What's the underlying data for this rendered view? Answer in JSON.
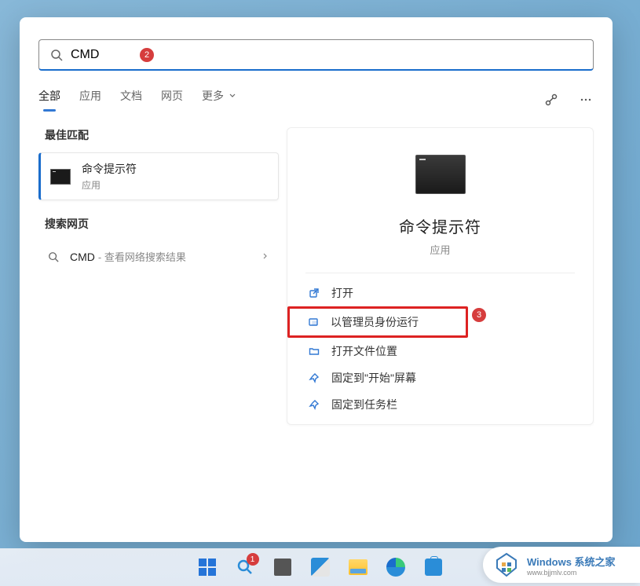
{
  "search": {
    "value": "CMD",
    "badge": "2"
  },
  "tabs": {
    "items": [
      "全部",
      "应用",
      "文档",
      "网页",
      "更多"
    ],
    "activeIndex": 0
  },
  "leftPanel": {
    "bestMatchHeader": "最佳匹配",
    "bestMatch": {
      "title": "命令提示符",
      "subtitle": "应用"
    },
    "webHeader": "搜索网页",
    "webResult": {
      "query": "CMD",
      "desc": " - 查看网络搜索结果"
    }
  },
  "rightPanel": {
    "appName": "命令提示符",
    "appType": "应用",
    "actions": [
      {
        "icon": "open-external",
        "label": "打开"
      },
      {
        "icon": "admin-shield",
        "label": "以管理员身份运行"
      },
      {
        "icon": "folder",
        "label": "打开文件位置"
      },
      {
        "icon": "pin",
        "label": "固定到\"开始\"屏幕"
      },
      {
        "icon": "pin",
        "label": "固定到任务栏"
      }
    ],
    "badge": "3"
  },
  "taskbar": {
    "searchBadge": "1"
  },
  "watermark": {
    "title": "Windows 系统之家",
    "url": "www.bjjmlv.com"
  },
  "colors": {
    "accent": "#1a6dcc",
    "red": "#d63d3d",
    "actionIcon": "#3279d4"
  }
}
